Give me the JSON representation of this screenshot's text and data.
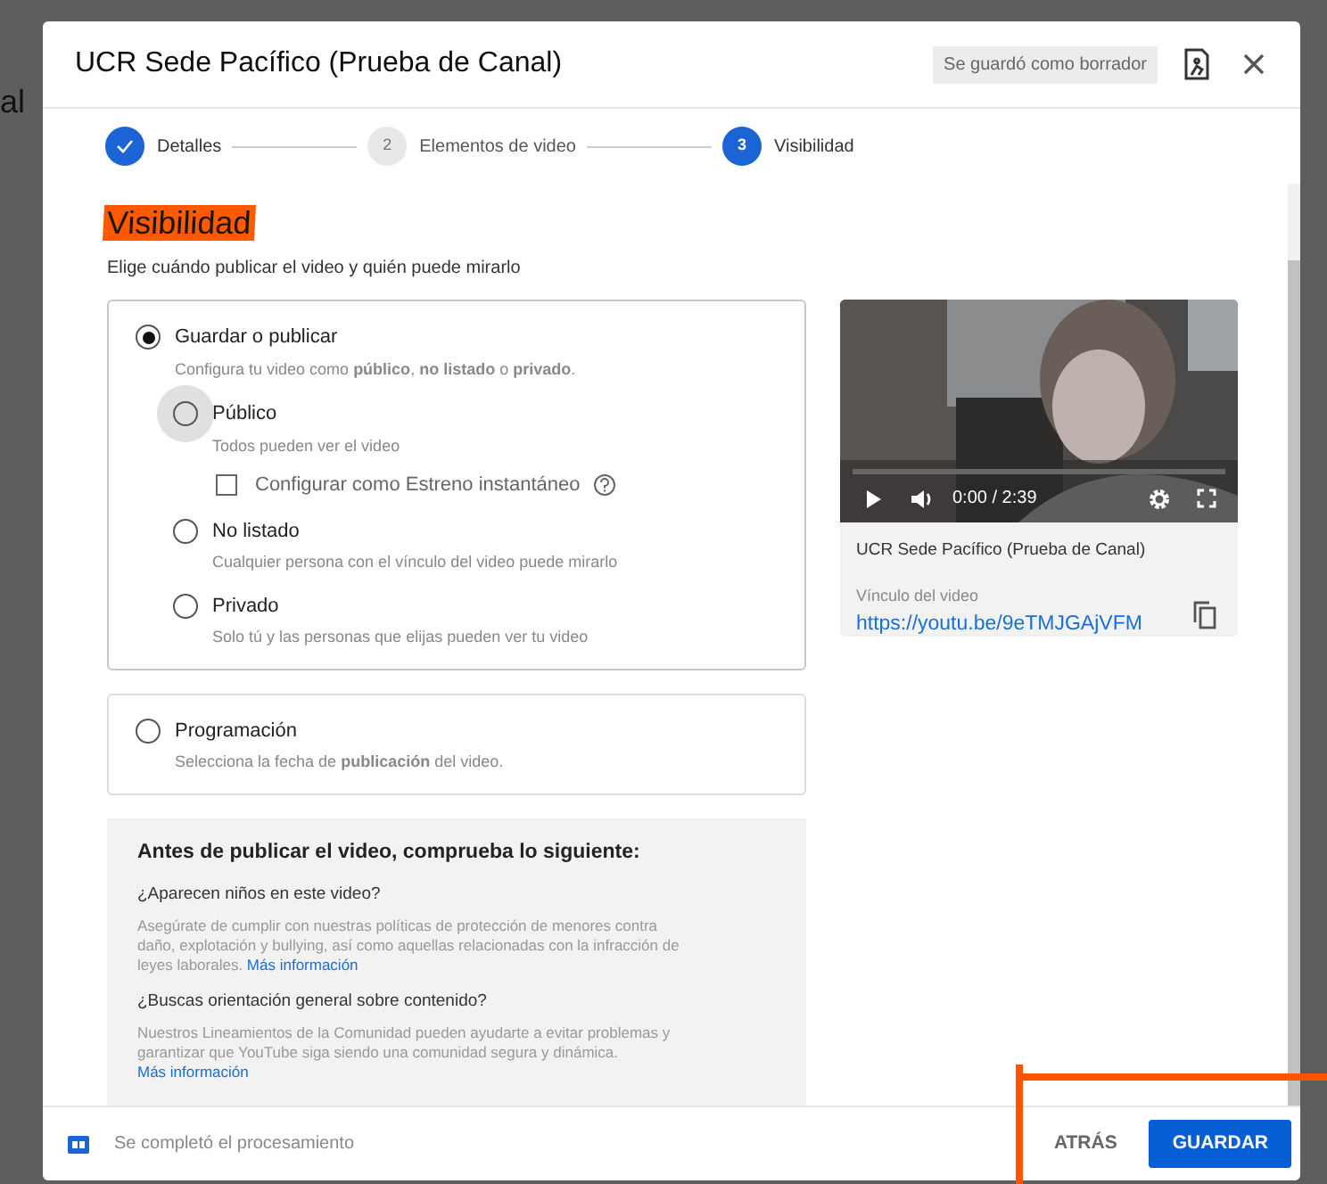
{
  "background_text": "al",
  "dialog": {
    "title": "UCR Sede Pacífico (Prueba de Canal)",
    "draft_badge": "Se guardó como borrador"
  },
  "stepper": [
    {
      "label": "Detalles",
      "completed": true,
      "selected": false
    },
    {
      "number": "2",
      "label": "Elementos de video",
      "completed": false,
      "selected": false
    },
    {
      "number": "3",
      "label": "Visibilidad",
      "completed": false,
      "selected": true
    }
  ],
  "visibility": {
    "heading": "Visibilidad",
    "subtitle": "Elige cuándo publicar el video y quién puede mirarlo",
    "save_or_publish": {
      "label": "Guardar o publicar",
      "selected": true,
      "description": "Configura tu video como **público**, **no listado** o **privado**."
    },
    "options": [
      {
        "label": "Público",
        "description": "Todos pueden ver el video",
        "selected": false,
        "hovered": true,
        "premiere": {
          "label": "Configurar como Estreno instantáneo",
          "checked": false
        }
      },
      {
        "label": "No listado",
        "description": "Cualquier persona con el vínculo del video puede mirarlo",
        "selected": false,
        "hovered": false
      },
      {
        "label": "Privado",
        "description": "Solo tú y las personas que elijas pueden ver tu video",
        "selected": false,
        "hovered": false
      }
    ],
    "schedule": {
      "label": "Programación",
      "selected": false,
      "description": "Selecciona la fecha de **publicación** del video."
    }
  },
  "checklist": {
    "title": "Antes de publicar el video, comprueba lo siguiente:",
    "items": [
      {
        "question": "¿Aparecen niños en este video?",
        "text": "Asegúrate de cumplir con nuestras políticas de protección de menores contra daño, explotación y bullying, así como aquellas relacionadas con la infracción de leyes laborales.",
        "link": "Más información"
      },
      {
        "question": "¿Buscas orientación general sobre contenido?",
        "text": "Nuestros Lineamientos de la Comunidad pueden ayudarte a evitar problemas y garantizar que YouTube siga siendo una comunidad segura y dinámica.",
        "link": "Más información"
      }
    ]
  },
  "video_card": {
    "time": "0:00 / 2:39",
    "title": "UCR Sede Pacífico (Prueba de Canal)",
    "link_label": "Vínculo del video",
    "link": "https://youtu.be/9eTMJGAjVFM"
  },
  "footer": {
    "status": "Se completó el procesamiento",
    "buttons": [
      {
        "label": "ATRÁS",
        "kind": "text"
      },
      {
        "label": "GUARDAR",
        "kind": "primary"
      }
    ]
  }
}
